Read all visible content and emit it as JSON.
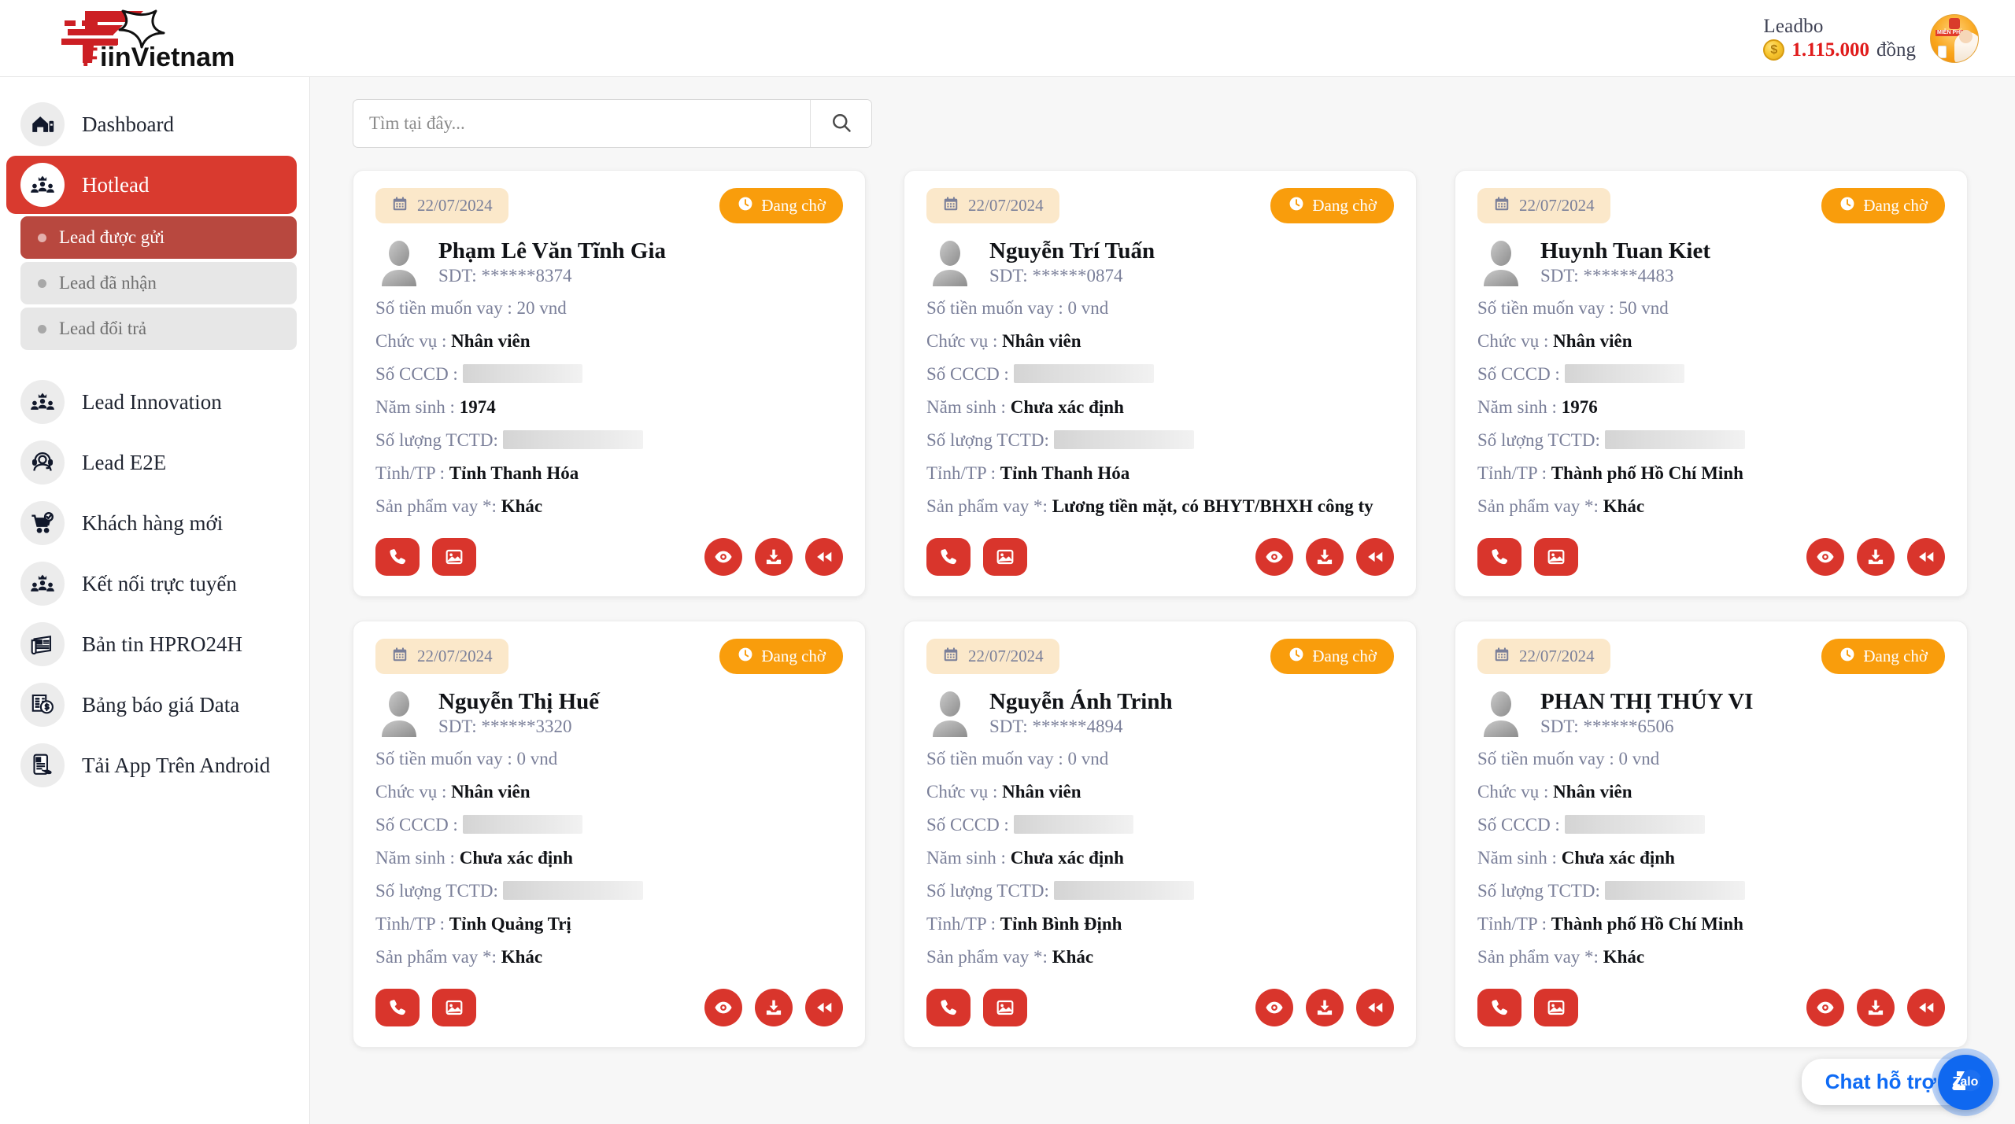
{
  "brand": {
    "name": "FiinVietnam",
    "logo_icon": "fiin-star-logo"
  },
  "header": {
    "user_name": "Leadbo",
    "balance_amount": "1.115.000",
    "balance_unit": "đồng",
    "coin_icon": "coin-icon",
    "avatar_icon": "user-avatar",
    "accent_red": "#e01b1b"
  },
  "sidebar": {
    "items": [
      {
        "label": "Dashboard",
        "icon": "home-icon",
        "active": false
      },
      {
        "label": "Hotlead",
        "icon": "crown-people-icon",
        "active": true
      },
      {
        "label": "Lead Innovation",
        "icon": "crown-people-icon",
        "active": false
      },
      {
        "label": "Lead E2E",
        "icon": "headset-agent-icon",
        "active": false
      },
      {
        "label": "Khách hàng mới",
        "icon": "cart-check-icon",
        "active": false
      },
      {
        "label": "Kết nối trực tuyến",
        "icon": "crown-people-icon",
        "active": false
      },
      {
        "label": "Bản tin HPRO24H",
        "icon": "newspaper-icon",
        "active": false
      },
      {
        "label": "Bảng báo giá Data",
        "icon": "invoice-dollar-icon",
        "active": false
      },
      {
        "label": "Tải App Trên Android",
        "icon": "mobile-app-icon",
        "active": false
      }
    ],
    "subitems": [
      {
        "label": "Lead được gửi",
        "active": true
      },
      {
        "label": "Lead đã nhận",
        "active": false
      },
      {
        "label": "Lead đổi trả",
        "active": false
      }
    ],
    "active_color": "#d93a2f",
    "subactive_color": "#b8483f"
  },
  "search": {
    "placeholder": "Tìm tại đây...",
    "value": "",
    "search_icon": "search-icon"
  },
  "card_labels": {
    "amount": "Số tiền muốn vay :",
    "position": "Chức vụ :",
    "id_number": "Số CCCD :",
    "birth_year": "Năm sinh :",
    "tctd_count": "Số lượng TCTD:",
    "province": "Tỉnh/TP :",
    "loan_product": "Sản phẩm vay *:",
    "phone_prefix": "SDT:",
    "calendar_icon": "calendar-icon",
    "clock_icon": "clock-icon"
  },
  "card_actions": [
    {
      "name": "call-button",
      "icon": "phone-icon"
    },
    {
      "name": "image-button",
      "icon": "image-icon"
    },
    {
      "name": "view-button",
      "icon": "eye-icon"
    },
    {
      "name": "download-button",
      "icon": "download-icon"
    },
    {
      "name": "return-button",
      "icon": "rewind-icon"
    }
  ],
  "cards": [
    {
      "date": "22/07/2024",
      "status": "Đang chờ",
      "name": "Phạm Lê Văn Tĩnh Gia",
      "phone": "******8374",
      "amount": "20 vnd",
      "position": "Nhân viên",
      "id_number": "",
      "birth_year": "1974",
      "tctd_count": "",
      "province": "Tỉnh Thanh Hóa",
      "loan_product": "Khác"
    },
    {
      "date": "22/07/2024",
      "status": "Đang chờ",
      "name": "Nguyễn Trí Tuấn",
      "phone": "******0874",
      "amount": "0 vnd",
      "position": "Nhân viên",
      "id_number": "",
      "birth_year": "Chưa xác định",
      "tctd_count": "",
      "province": "Tỉnh Thanh Hóa",
      "loan_product": "Lương tiền mặt, có BHYT/BHXH công ty"
    },
    {
      "date": "22/07/2024",
      "status": "Đang chờ",
      "name": "Huynh Tuan Kiet",
      "phone": "******4483",
      "amount": "50 vnd",
      "position": "Nhân viên",
      "id_number": "",
      "birth_year": "1976",
      "tctd_count": "",
      "province": "Thành phố Hồ Chí Minh",
      "loan_product": "Khác"
    },
    {
      "date": "22/07/2024",
      "status": "Đang chờ",
      "name": "Nguyễn Thị Huế",
      "phone": "******3320",
      "amount": "0 vnd",
      "position": "Nhân viên",
      "id_number": "",
      "birth_year": "Chưa xác định",
      "tctd_count": "",
      "province": "Tỉnh Quảng Trị",
      "loan_product": "Khác"
    },
    {
      "date": "22/07/2024",
      "status": "Đang chờ",
      "name": "Nguyễn Ánh Trinh",
      "phone": "******4894",
      "amount": "0 vnd",
      "position": "Nhân viên",
      "id_number": "",
      "birth_year": "Chưa xác định",
      "tctd_count": "",
      "province": "Tỉnh Bình Định",
      "loan_product": "Khác"
    },
    {
      "date": "22/07/2024",
      "status": "Đang chờ",
      "name": "PHAN THỊ THÚY VI",
      "phone": "******6506",
      "amount": "0 vnd",
      "position": "Nhân viên",
      "id_number": "",
      "birth_year": "Chưa xác định",
      "tctd_count": "",
      "province": "Thành phố Hồ Chí Minh",
      "loan_product": "Khác"
    }
  ],
  "chat": {
    "label": "Chat hỗ trợ",
    "zalo_label": "Zalo",
    "zalo_icon": "zalo-icon",
    "color": "#0f68f0"
  }
}
